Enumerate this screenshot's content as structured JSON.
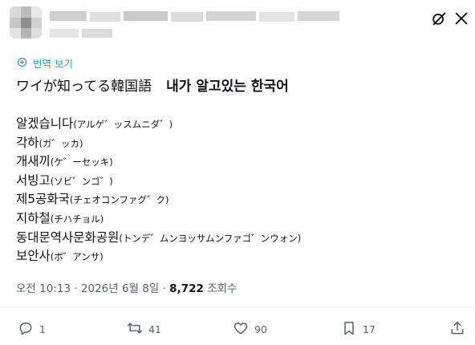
{
  "post": {
    "translate_label": "번역 보기",
    "title_jp": "ワイが知ってる韓国語",
    "title_ko": "내가 알고있는 한국어",
    "lines": [
      {
        "ko": "알겠습니다",
        "jp": "(アルゲ゛ッスムニダ゛)"
      },
      {
        "ko": "각하",
        "jp": "(ガ゛ッカ)"
      },
      {
        "ko": "개새끼",
        "jp": "(ケ゛ーセッキ)"
      },
      {
        "ko": "서빙고",
        "jp": "(ソビ゛ンゴ゛)"
      },
      {
        "ko": "제5공화국",
        "jp": "(チェオコンファグ゛ク)"
      },
      {
        "ko": "지하철",
        "jp": "(チハチョル)"
      },
      {
        "ko": "동대문역사문화공원",
        "jp": "(トンデ゛ムンヨッサムンファゴ゛ンウォン)"
      },
      {
        "ko": "보안사",
        "jp": "(ボ゛アンサ)"
      }
    ],
    "meta_time": "오전 10:13 · 2026년 6월 8일 · ",
    "meta_views": "8,722",
    "meta_views_label": " 조회수"
  },
  "actions": {
    "reply_count": "1",
    "repost_count": "41",
    "like_count": "90",
    "bookmark_count": "17"
  },
  "colors": {
    "accent": "#1d9bf0",
    "muted": "#536471",
    "text": "#0f1419"
  },
  "icons": [
    "grok-icon",
    "close-icon",
    "translate-icon",
    "reply-icon",
    "repost-icon",
    "like-icon",
    "bookmark-icon",
    "share-icon"
  ]
}
